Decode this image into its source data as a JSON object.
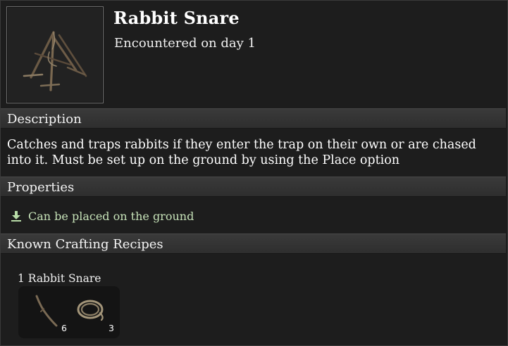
{
  "item": {
    "name": "Rabbit Snare",
    "encountered": "Encountered on day 1",
    "icon": "rabbit-snare-icon"
  },
  "sections": {
    "description_header": "Description",
    "description_text": "Catches and traps rabbits if they enter the trap on their own or are chased into it. Must be set up on the ground by using the Place option",
    "properties_header": "Properties",
    "properties": [
      {
        "icon": "download-arrow-icon",
        "text": "Can be placed on the ground",
        "color": "#c6e2b8"
      }
    ],
    "recipes_header": "Known Crafting Recipes"
  },
  "recipes": [
    {
      "title": "1 Rabbit Snare",
      "ingredients": [
        {
          "icon": "stick-icon",
          "quantity": "6"
        },
        {
          "icon": "rope-coil-icon",
          "quantity": "3"
        }
      ]
    }
  ]
}
